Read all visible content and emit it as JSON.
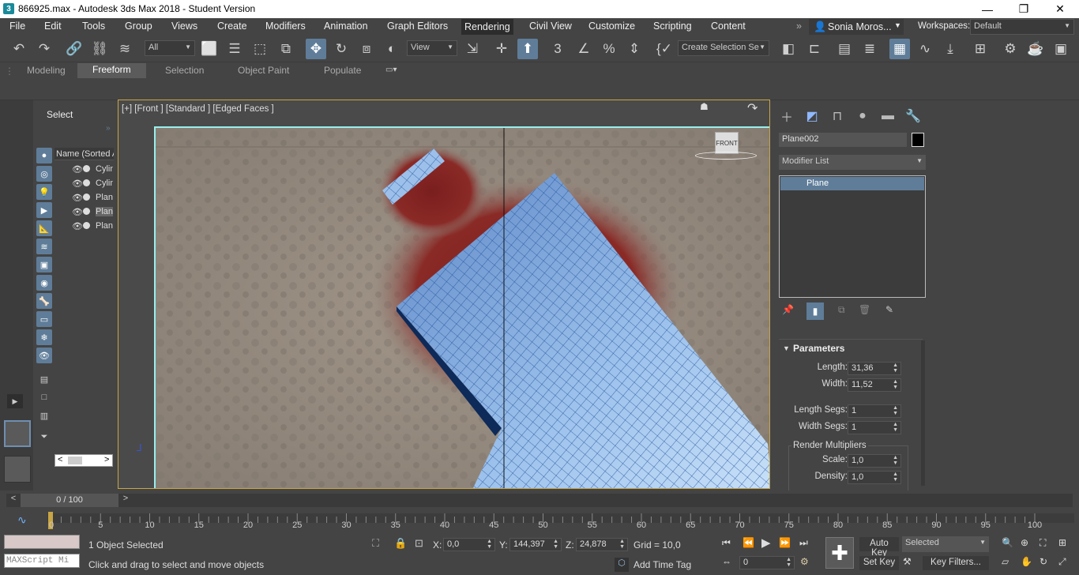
{
  "window": {
    "title": "866925.max - Autodesk 3ds Max 2018 - Student Version",
    "app_icon": "3"
  },
  "menu": {
    "items": [
      "File",
      "Edit",
      "Tools",
      "Group",
      "Views",
      "Create",
      "Modifiers",
      "Animation",
      "Graph Editors",
      "Rendering",
      "Civil View",
      "Customize",
      "Scripting",
      "Content"
    ],
    "user": "Sonia Moros...",
    "workspaces_label": "Workspaces:",
    "workspace": "Default"
  },
  "toolbar": {
    "filter": "All",
    "view": "View",
    "selection_set": "Create Selection Se"
  },
  "ribbon": {
    "tabs": [
      "Modeling",
      "Freeform",
      "Selection",
      "Object Paint",
      "Populate"
    ]
  },
  "scene_explorer": {
    "title": "Select",
    "column": "Name (Sorted A",
    "rows": [
      "Cylin",
      "Cylin",
      "Plan",
      "Plan",
      "Plan"
    ]
  },
  "viewport": {
    "label": "[+] [Front ] [Standard ] [Edged Faces ]",
    "cube": "FRONT"
  },
  "command_panel": {
    "object_name": "Plane002",
    "modifier_list": "Modifier List",
    "stack_item": "Plane",
    "rollout": "Parameters",
    "params": [
      {
        "label": "Length:",
        "value": "31,36"
      },
      {
        "label": "Width:",
        "value": "11,52"
      },
      {
        "label": "Length Segs:",
        "value": "1"
      },
      {
        "label": "Width Segs:",
        "value": "1"
      }
    ],
    "render_group": "Render Multipliers",
    "render_params": [
      {
        "label": "Scale:",
        "value": "1,0"
      },
      {
        "label": "Density:",
        "value": "1,0"
      }
    ]
  },
  "timeline": {
    "frame": "0 / 100",
    "ticks": [
      "0",
      "5",
      "10",
      "15",
      "20",
      "25",
      "30",
      "35",
      "40",
      "45",
      "50",
      "55",
      "60",
      "65",
      "70",
      "75",
      "80",
      "85",
      "90",
      "95",
      "100"
    ]
  },
  "status": {
    "maxscript": "MAXScript Mi",
    "selected": "1 Object Selected",
    "prompt": "Click and drag to select and move objects",
    "x": "0,0",
    "y": "144,397",
    "z": "24,878",
    "grid": "Grid = 10,0",
    "add_time_tag": "Add Time Tag",
    "auto_key": "Auto Key",
    "set_key": "Set Key",
    "key_mode": "Selected",
    "key_filters": "Key Filters...",
    "current_frame": "0"
  },
  "colors": {
    "accent": "#5f7d99",
    "viewport_border": "#c8a545",
    "wire": "#1f4f99",
    "surface": "#a8c9ef"
  }
}
